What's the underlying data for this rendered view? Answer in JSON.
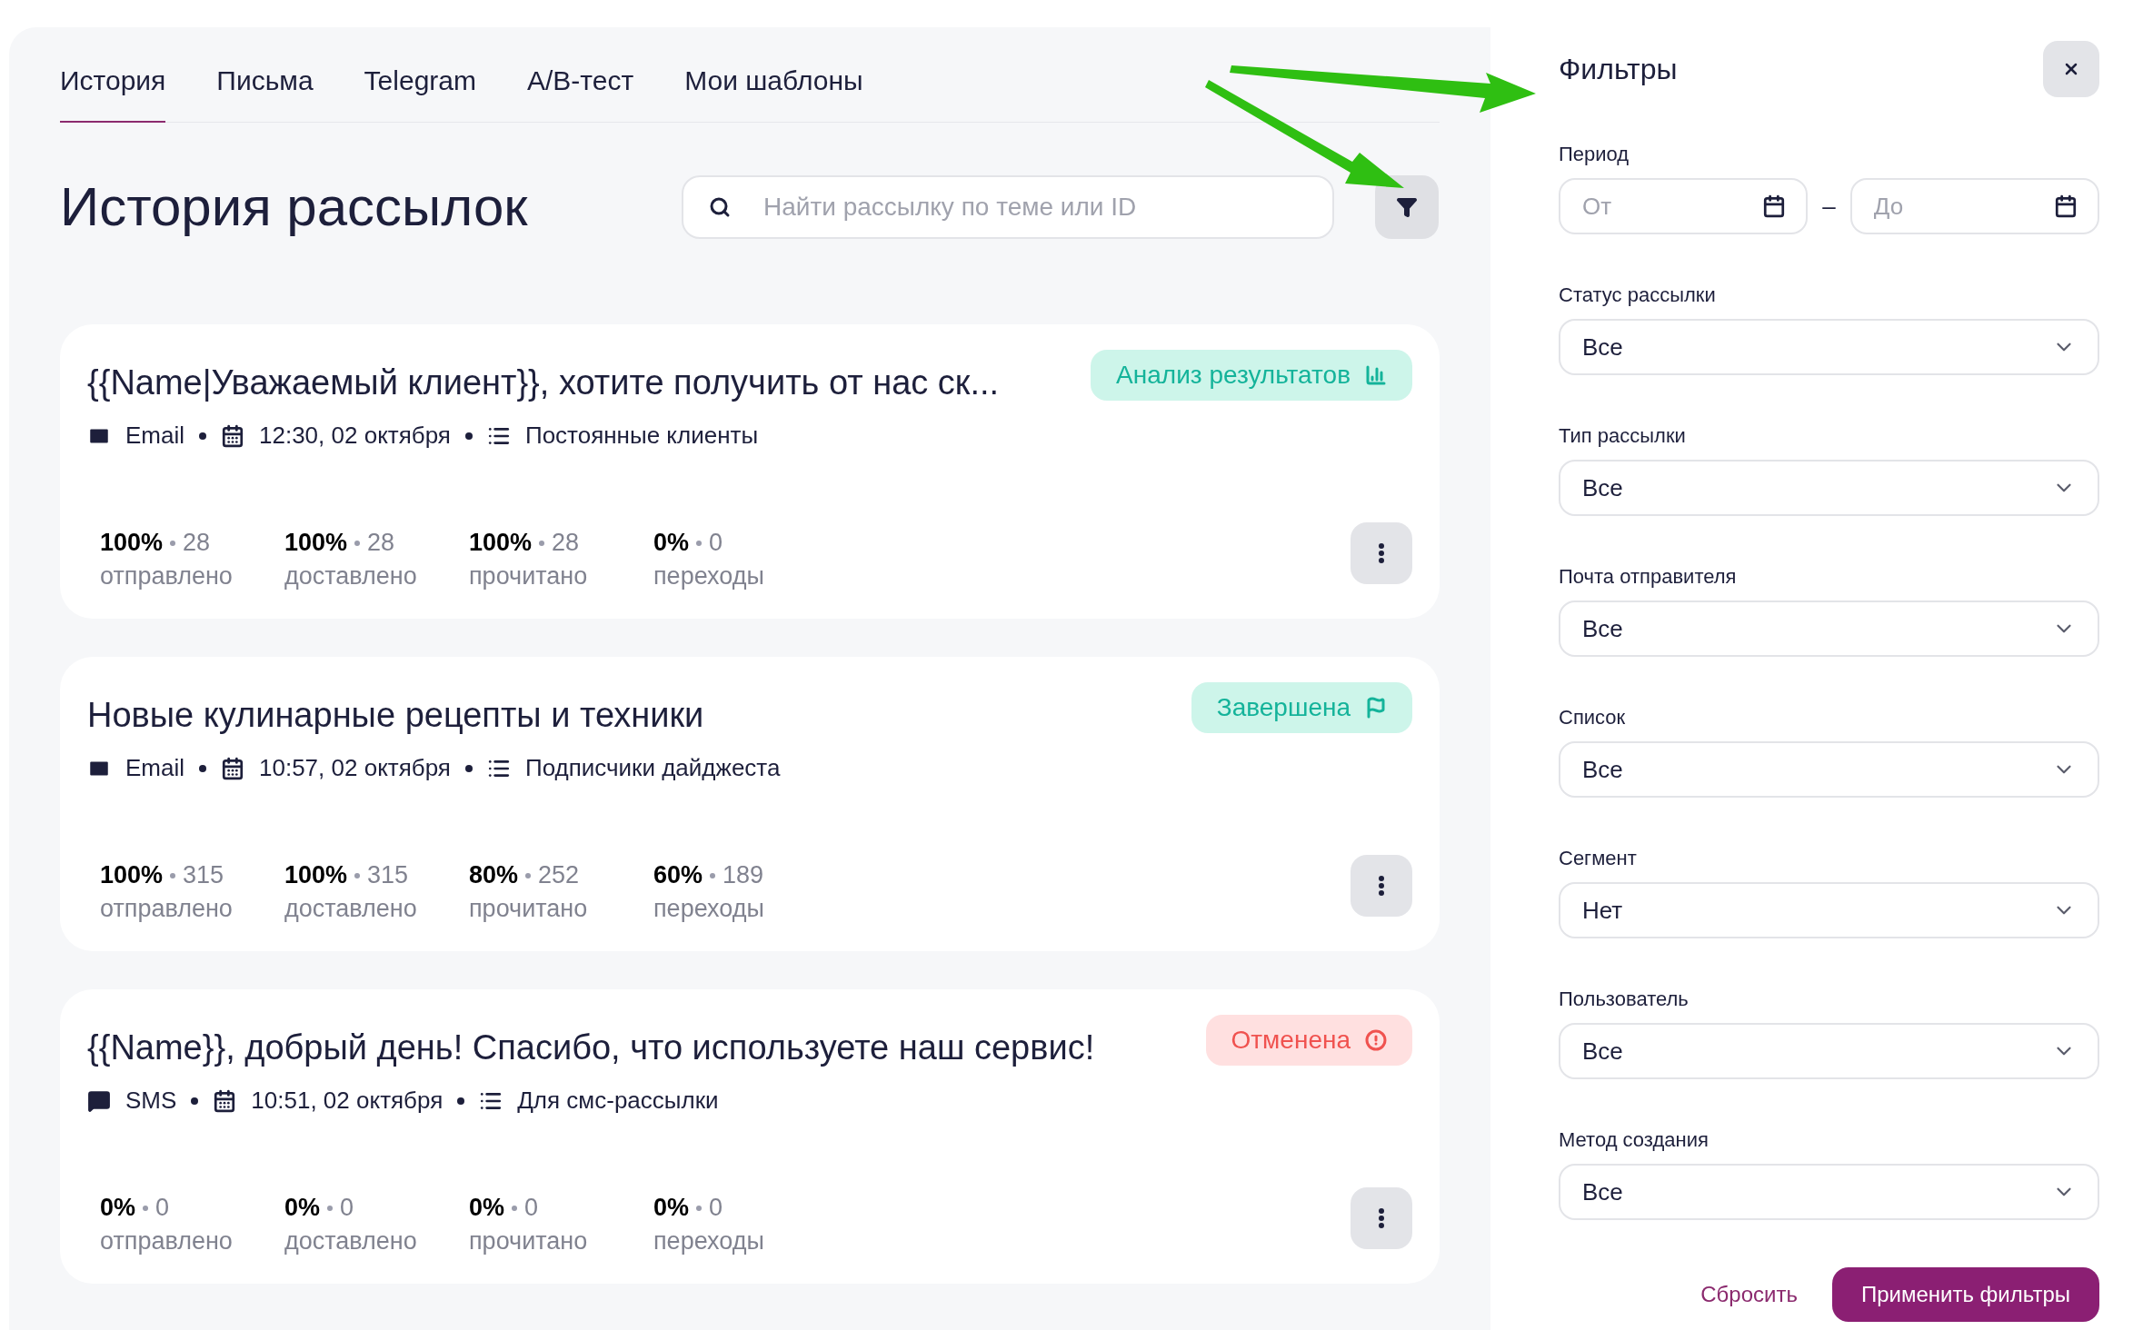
{
  "tabs": [
    {
      "label": "История",
      "selected": true
    },
    {
      "label": "Письма",
      "selected": false
    },
    {
      "label": "Telegram",
      "selected": false
    },
    {
      "label": "A/B-тест",
      "selected": false
    },
    {
      "label": "Мои шаблоны",
      "selected": false
    }
  ],
  "page_title": "История рассылок",
  "search": {
    "placeholder": "Найти рассылку по теме или ID"
  },
  "campaigns": [
    {
      "title": "{{Name|Уважаемый клиент}}, хотите получить от нас ск...",
      "status": {
        "kind": "analysis",
        "label": "Анализ результатов"
      },
      "channel": {
        "kind": "email",
        "label": "Email"
      },
      "date": "12:30, 02 октября",
      "list": "Постоянные клиенты",
      "stats": [
        {
          "percent": "100%",
          "count": "28",
          "label": "отправлено"
        },
        {
          "percent": "100%",
          "count": "28",
          "label": "доставлено"
        },
        {
          "percent": "100%",
          "count": "28",
          "label": "прочитано"
        },
        {
          "percent": "0%",
          "count": "0",
          "label": "переходы"
        }
      ]
    },
    {
      "title": "Новые кулинарные рецепты и техники",
      "status": {
        "kind": "done",
        "label": "Завершена"
      },
      "channel": {
        "kind": "email",
        "label": "Email"
      },
      "date": "10:57, 02 октября",
      "list": "Подписчики дайджеста",
      "stats": [
        {
          "percent": "100%",
          "count": "315",
          "label": "отправлено"
        },
        {
          "percent": "100%",
          "count": "315",
          "label": "доставлено"
        },
        {
          "percent": "80%",
          "count": "252",
          "label": "прочитано"
        },
        {
          "percent": "60%",
          "count": "189",
          "label": "переходы"
        }
      ]
    },
    {
      "title": "{{Name}}, добрый день! Спасибо, что используете наш сервис!",
      "status": {
        "kind": "canceled",
        "label": "Отменена"
      },
      "channel": {
        "kind": "sms",
        "label": "SMS"
      },
      "date": "10:51, 02 октября",
      "list": "Для смс-рассылки",
      "stats": [
        {
          "percent": "0%",
          "count": "0",
          "label": "отправлено"
        },
        {
          "percent": "0%",
          "count": "0",
          "label": "доставлено"
        },
        {
          "percent": "0%",
          "count": "0",
          "label": "прочитано"
        },
        {
          "percent": "0%",
          "count": "0",
          "label": "переходы"
        }
      ]
    }
  ],
  "filters": {
    "title": "Фильтры",
    "period": {
      "label": "Период",
      "from_placeholder": "От",
      "to_placeholder": "До",
      "separator": "–"
    },
    "selects": [
      {
        "label": "Статус рассылки",
        "value": "Все"
      },
      {
        "label": "Тип рассылки",
        "value": "Все"
      },
      {
        "label": "Почта отправителя",
        "value": "Все"
      },
      {
        "label": "Список",
        "value": "Все"
      },
      {
        "label": "Сегмент",
        "value": "Нет"
      },
      {
        "label": "Пользователь",
        "value": "Все"
      },
      {
        "label": "Метод создания",
        "value": "Все"
      }
    ],
    "reset": "Сбросить",
    "apply": "Применить фильтры"
  }
}
